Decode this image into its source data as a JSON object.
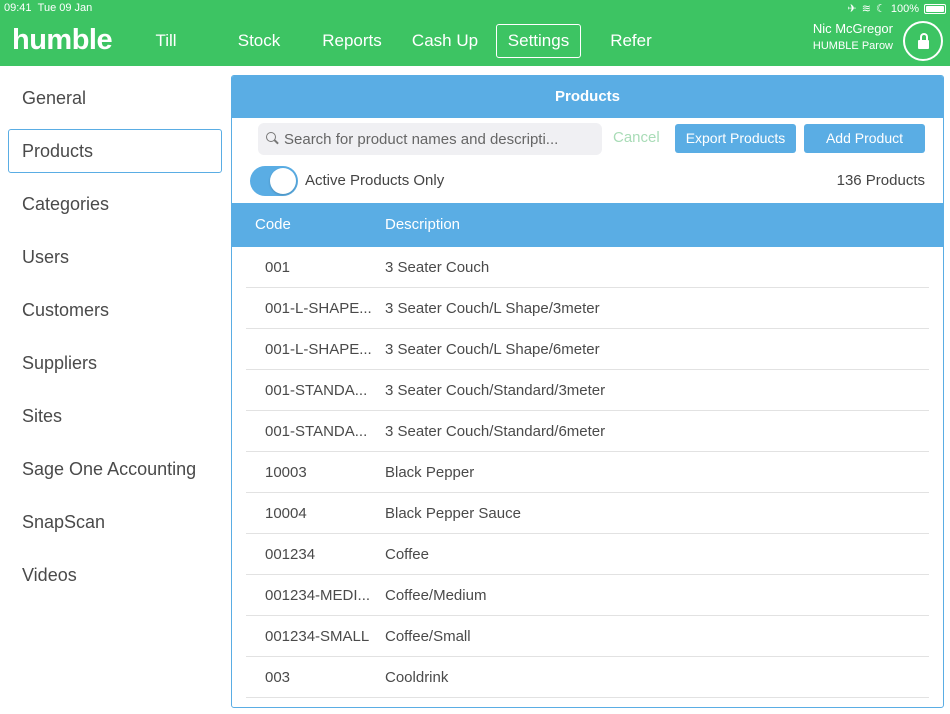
{
  "status_bar": {
    "time": "09:41",
    "date": "Tue 09 Jan",
    "battery": "100%",
    "icons": [
      "airplane-icon",
      "wifi-icon",
      "moon-icon",
      "battery-icon"
    ]
  },
  "header": {
    "logo": "humble",
    "nav": [
      {
        "label": "Till"
      },
      {
        "label": "Stock"
      },
      {
        "label": "Reports"
      },
      {
        "label": "Cash Up"
      },
      {
        "label": "Settings",
        "active": true
      },
      {
        "label": "Refer"
      }
    ],
    "user_name": "Nic McGregor",
    "site": "HUMBLE Parow"
  },
  "sidebar": {
    "items": [
      {
        "label": "General"
      },
      {
        "label": "Products",
        "active": true
      },
      {
        "label": "Categories"
      },
      {
        "label": "Users"
      },
      {
        "label": "Customers"
      },
      {
        "label": "Suppliers"
      },
      {
        "label": "Sites"
      },
      {
        "label": "Sage One Accounting"
      },
      {
        "label": "SnapScan"
      },
      {
        "label": "Videos"
      }
    ]
  },
  "products": {
    "title": "Products",
    "search_placeholder": "Search for product names and descripti...",
    "cancel_label": "Cancel",
    "export_label": "Export Products",
    "add_label": "Add Product",
    "active_only_label": "Active Products Only",
    "active_only": true,
    "count_label": "136 Products",
    "columns": {
      "code": "Code",
      "description": "Description"
    },
    "rows": [
      {
        "code": "001",
        "description": "3 Seater Couch"
      },
      {
        "code": "001-L-SHAPE...",
        "description": "3 Seater Couch/L Shape/3meter"
      },
      {
        "code": "001-L-SHAPE...",
        "description": "3 Seater Couch/L Shape/6meter"
      },
      {
        "code": "001-STANDA...",
        "description": "3 Seater Couch/Standard/3meter"
      },
      {
        "code": "001-STANDA...",
        "description": "3 Seater Couch/Standard/6meter"
      },
      {
        "code": "10003",
        "description": "Black Pepper"
      },
      {
        "code": "10004",
        "description": "Black Pepper Sauce"
      },
      {
        "code": "001234",
        "description": "Coffee"
      },
      {
        "code": "001234-MEDI...",
        "description": "Coffee/Medium"
      },
      {
        "code": "001234-SMALL",
        "description": "Coffee/Small"
      },
      {
        "code": "003",
        "description": "Cooldrink"
      }
    ]
  },
  "colors": {
    "header_green": "#3dc463",
    "accent_blue": "#5aade4",
    "cancel_disabled": "#a9dcb7"
  }
}
